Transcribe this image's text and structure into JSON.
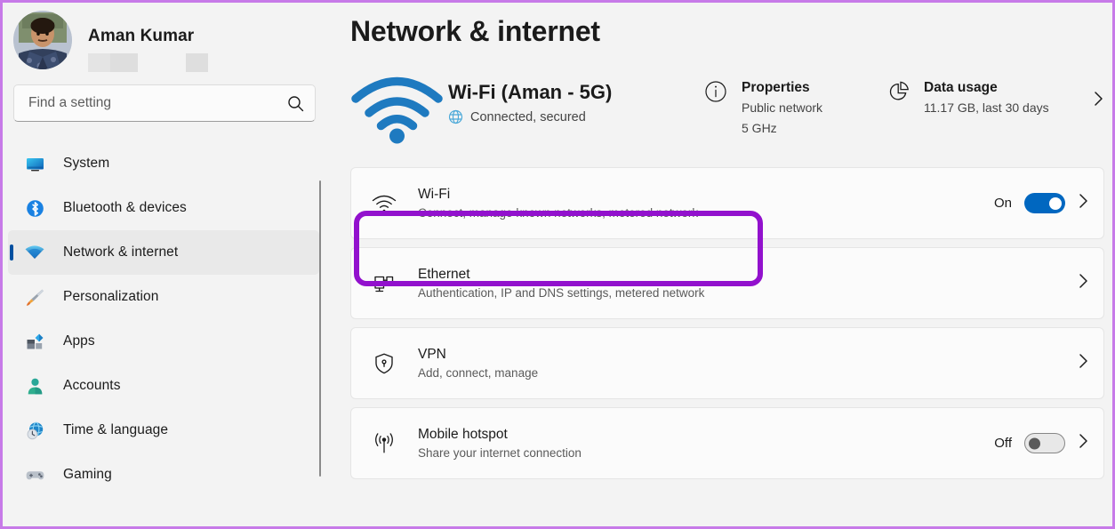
{
  "window": {
    "accent_border": "#c77ae8"
  },
  "profile": {
    "name": "Aman Kumar",
    "avatar_alt": "user-avatar"
  },
  "search": {
    "placeholder": "Find a setting",
    "value": "",
    "icon": "search-icon"
  },
  "sidebar": {
    "items": [
      {
        "label": "System",
        "icon": "monitor-icon",
        "selected": false
      },
      {
        "label": "Bluetooth & devices",
        "icon": "bluetooth-icon",
        "selected": false
      },
      {
        "label": "Network & internet",
        "icon": "wifi-icon",
        "selected": true
      },
      {
        "label": "Personalization",
        "icon": "paintbrush-icon",
        "selected": false
      },
      {
        "label": "Apps",
        "icon": "apps-icon",
        "selected": false
      },
      {
        "label": "Accounts",
        "icon": "person-icon",
        "selected": false
      },
      {
        "label": "Time & language",
        "icon": "clock-globe-icon",
        "selected": false
      },
      {
        "label": "Gaming",
        "icon": "gamepad-icon",
        "selected": false
      }
    ]
  },
  "header": {
    "title": "Network & internet"
  },
  "status": {
    "wifi_icon": "wifi-signal-icon",
    "ssid": "Wi-Fi (Aman - 5G)",
    "connection_icon": "globe-icon",
    "connection_state": "Connected, secured",
    "properties": {
      "icon": "info-circle-icon",
      "title": "Properties",
      "line1": "Public network",
      "line2": "5 GHz"
    },
    "data_usage": {
      "icon": "pie-chart-icon",
      "title": "Data usage",
      "line1": "11.17 GB, last 30 days"
    },
    "chevron": "chevron-right-icon"
  },
  "settings": [
    {
      "icon": "wifi-icon",
      "title": "Wi-Fi",
      "subtitle": "Connect, manage known networks, metered network",
      "toggle": {
        "state": "On",
        "value": true
      },
      "chevron": "chevron-right-icon",
      "highlighted": true
    },
    {
      "icon": "ethernet-icon",
      "title": "Ethernet",
      "subtitle": "Authentication, IP and DNS settings, metered network",
      "toggle": null,
      "chevron": "chevron-right-icon",
      "highlighted": false
    },
    {
      "icon": "shield-icon",
      "title": "VPN",
      "subtitle": "Add, connect, manage",
      "toggle": null,
      "chevron": "chevron-right-icon",
      "highlighted": false
    },
    {
      "icon": "hotspot-icon",
      "title": "Mobile hotspot",
      "subtitle": "Share your internet connection",
      "toggle": {
        "state": "Off",
        "value": false
      },
      "chevron": "chevron-right-icon",
      "highlighted": false
    }
  ],
  "annotation": {
    "color": "#9211cd",
    "target": "Wi-Fi"
  },
  "colors": {
    "accent_blue": "#0067c0",
    "selected_bar": "#0050a0",
    "annotation_purple": "#9211cd",
    "window_border": "#c77ae8"
  }
}
